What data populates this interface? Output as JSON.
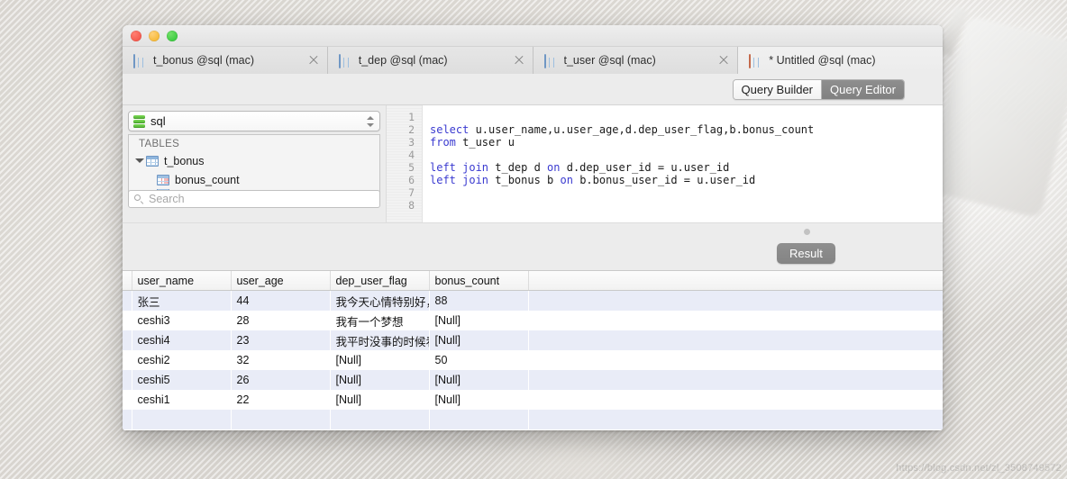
{
  "window": {
    "traffic_lights": [
      "close",
      "minimize",
      "zoom"
    ]
  },
  "tabs": [
    {
      "label": "t_bonus @sql (mac)",
      "icon": "table-grid-icon",
      "active": false,
      "closable": true
    },
    {
      "label": "t_dep @sql (mac)",
      "icon": "table-grid-icon",
      "active": false,
      "closable": true
    },
    {
      "label": "t_user @sql (mac)",
      "icon": "table-grid-icon",
      "active": false,
      "closable": true
    },
    {
      "label": "* Untitled @sql (mac)",
      "icon": "query-editor-icon",
      "active": true,
      "closable": false
    }
  ],
  "toolbar": {
    "segments": [
      {
        "label": "Query Builder",
        "selected": false
      },
      {
        "label": "Query Editor",
        "selected": true
      }
    ]
  },
  "sidebar": {
    "database": {
      "name": "sql",
      "icon": "database-icon",
      "stepper_icon": "up-down-stepper-icon"
    },
    "section_header": "TABLES",
    "tree": [
      {
        "label": "t_bonus",
        "icon": "table-grid-icon",
        "expanded": true,
        "level": 0
      },
      {
        "label": "bonus_count",
        "icon": "table-column-icon",
        "level": 1
      }
    ],
    "search": {
      "placeholder": "Search",
      "value": "",
      "icon": "search-icon"
    }
  },
  "editor": {
    "line_numbers": [
      "1",
      "2",
      "3",
      "4",
      "5",
      "6",
      "7",
      "8"
    ],
    "lines": [
      {
        "n": 1,
        "tokens": []
      },
      {
        "n": 2,
        "tokens": [
          {
            "t": "select ",
            "kw": true
          },
          {
            "t": "u.user_name,u.user_age,d.dep_user_flag,b.bonus_count",
            "kw": false
          }
        ]
      },
      {
        "n": 3,
        "tokens": [
          {
            "t": "from ",
            "kw": true
          },
          {
            "t": "t_user u",
            "kw": false
          }
        ]
      },
      {
        "n": 4,
        "tokens": []
      },
      {
        "n": 5,
        "tokens": [
          {
            "t": "left join ",
            "kw": true
          },
          {
            "t": "t_dep d ",
            "kw": false
          },
          {
            "t": "on ",
            "kw": true
          },
          {
            "t": "d.dep_user_id = u.user_id",
            "kw": false
          }
        ]
      },
      {
        "n": 6,
        "tokens": [
          {
            "t": "left join ",
            "kw": true
          },
          {
            "t": "t_bonus b ",
            "kw": false
          },
          {
            "t": "on ",
            "kw": true
          },
          {
            "t": "b.bonus_user_id = u.user_id",
            "kw": false
          }
        ]
      },
      {
        "n": 7,
        "tokens": []
      },
      {
        "n": 8,
        "tokens": []
      }
    ],
    "sql_text": "select u.user_name,u.user_age,d.dep_user_flag,b.bonus_count\nfrom t_user u\n\nleft join t_dep d on d.dep_user_id = u.user_id\nleft join t_bonus b on b.bonus_user_id = u.user_id"
  },
  "result_bar": {
    "button_label": "Result"
  },
  "results": {
    "columns": [
      "user_name",
      "user_age",
      "dep_user_flag",
      "bonus_count"
    ],
    "rows": [
      {
        "user_name": "张三",
        "user_age": "44",
        "dep_user_flag": "我今天心情特别好，",
        "bonus_count": "88"
      },
      {
        "user_name": "ceshi3",
        "user_age": "28",
        "dep_user_flag": "我有一个梦想",
        "bonus_count": "[Null]"
      },
      {
        "user_name": "ceshi4",
        "user_age": "23",
        "dep_user_flag": "我平时没事的时候看书",
        "bonus_count": "[Null]"
      },
      {
        "user_name": "ceshi2",
        "user_age": "32",
        "dep_user_flag": "[Null]",
        "bonus_count": "50"
      },
      {
        "user_name": "ceshi5",
        "user_age": "26",
        "dep_user_flag": "[Null]",
        "bonus_count": "[Null]"
      },
      {
        "user_name": "ceshi1",
        "user_age": "22",
        "dep_user_flag": "[Null]",
        "bonus_count": "[Null]"
      }
    ],
    "null_token": "[Null]",
    "empty_row_count": 2
  },
  "watermark": "https://blog.csdn.net/zl_3508749572",
  "colors": {
    "selected_segment_bg": "#858585",
    "sql_keyword": "#3a3ad0",
    "row_alt_bg": "#e9ecf7",
    "null_text": "#b0b0b0",
    "result_button_bg": "#8a8a8a",
    "db_icon_green": "#4caf2e",
    "tab_icon_blue": "#7097c4",
    "active_tab_icon_orange": "#e8633a"
  }
}
